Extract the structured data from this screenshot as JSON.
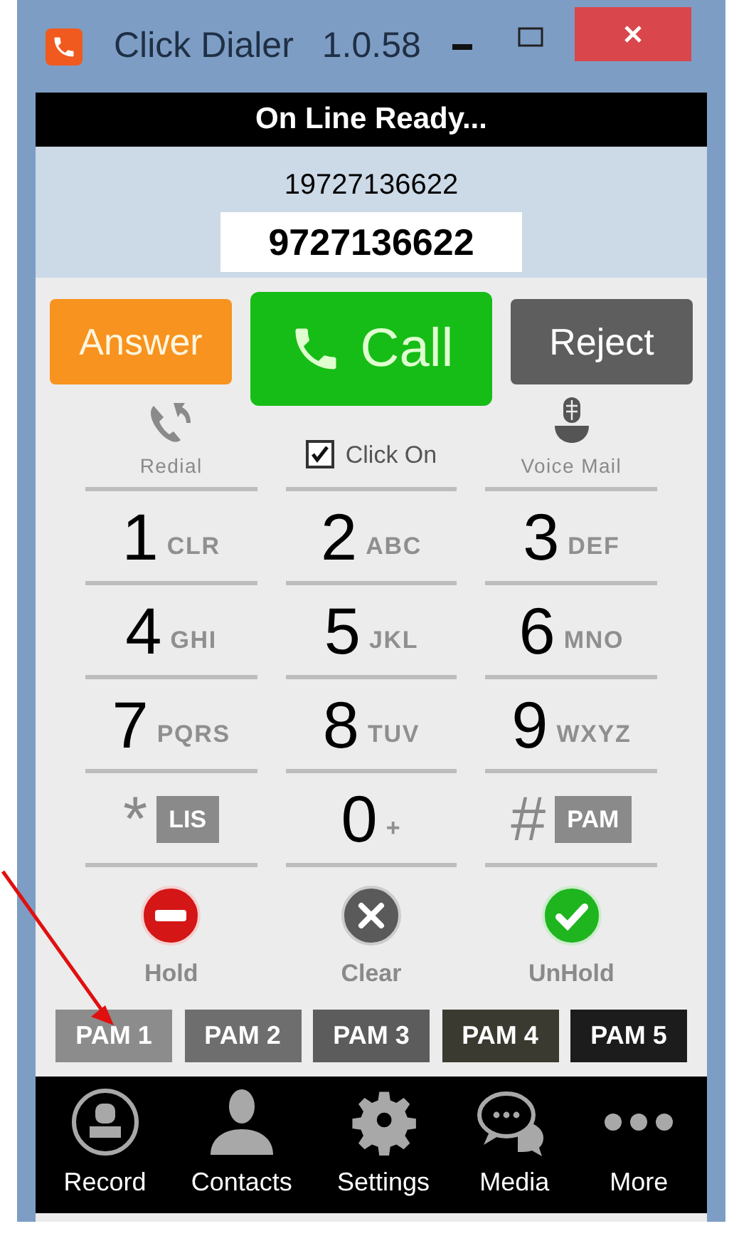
{
  "window": {
    "title": "Click Dialer",
    "version": "1.0.58"
  },
  "status": "On Line Ready...",
  "caller_number": "19727136622",
  "dial_field": {
    "value": "9727136622"
  },
  "actions": [
    {
      "label": "Answer",
      "kind": "answer"
    },
    {
      "label": "Call",
      "kind": "call"
    },
    {
      "label": "Reject",
      "kind": "reject"
    }
  ],
  "options": [
    {
      "label": "Redial",
      "kind": "redial"
    },
    {
      "label": "Click On",
      "kind": "checkbox",
      "checked": true
    },
    {
      "label": "Voice Mail",
      "kind": "voicemail"
    }
  ],
  "keys": [
    {
      "digit": "1",
      "letters": "CLR"
    },
    {
      "digit": "2",
      "letters": "ABC"
    },
    {
      "digit": "3",
      "letters": "DEF"
    },
    {
      "digit": "4",
      "letters": "GHI"
    },
    {
      "digit": "5",
      "letters": "JKL"
    },
    {
      "digit": "6",
      "letters": "MNO"
    },
    {
      "digit": "7",
      "letters": "PQRS"
    },
    {
      "digit": "8",
      "letters": "TUV"
    },
    {
      "digit": "9",
      "letters": "WXYZ"
    },
    {
      "digit": "*",
      "tag": "LIS"
    },
    {
      "digit": "0",
      "letters": "+"
    },
    {
      "digit": "#",
      "tag": "PAM"
    }
  ],
  "call_controls": [
    {
      "label": "Hold",
      "kind": "hold"
    },
    {
      "label": "Clear",
      "kind": "clear"
    },
    {
      "label": "UnHold",
      "kind": "unhold"
    }
  ],
  "pam_buttons": [
    {
      "label": "PAM 1",
      "color": "#8c8c8c"
    },
    {
      "label": "PAM 2",
      "color": "#6e6e6e"
    },
    {
      "label": "PAM 3",
      "color": "#5c5c5c"
    },
    {
      "label": "PAM 4",
      "color": "#3a3a30"
    },
    {
      "label": "PAM 5",
      "color": "#1c1c1c"
    }
  ],
  "bottom_nav": [
    {
      "label": "Record",
      "kind": "record"
    },
    {
      "label": "Contacts",
      "kind": "contacts"
    },
    {
      "label": "Settings",
      "kind": "settings"
    },
    {
      "label": "Media",
      "kind": "media"
    },
    {
      "label": "More",
      "kind": "more"
    }
  ]
}
